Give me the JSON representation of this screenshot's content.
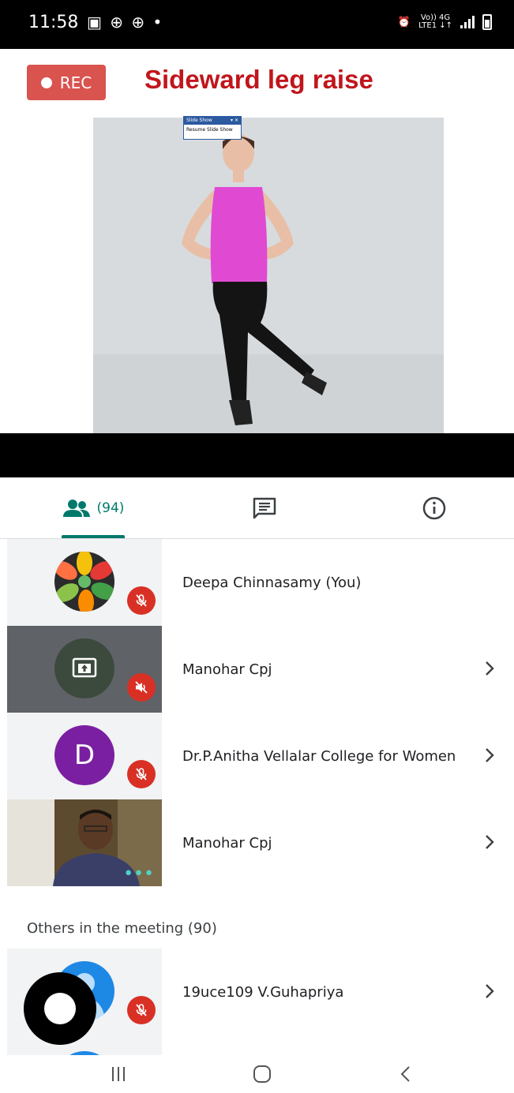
{
  "status_bar": {
    "time": "11:58",
    "network_top": "Vo)) 4G",
    "network_bottom": "LTE1 ↓↑"
  },
  "slide": {
    "rec_label": "REC",
    "title": "Sideward leg raise",
    "slideshow_toolbar": {
      "title": "Slide Show",
      "resume_label": "Resume Slide Show"
    }
  },
  "tabs": {
    "people_count": "(94)",
    "active_tab": "people",
    "accent_color": "#00796b"
  },
  "participants": [
    {
      "name": "Deepa Chinnasamy (You)",
      "avatar": "fruit-photo-avatar",
      "muted": true,
      "has_chevron": false
    },
    {
      "name": "Manohar Cpj",
      "avatar": "screen-share-icon",
      "muted": true,
      "has_chevron": true
    },
    {
      "name": "Dr.P.Anitha Vellalar College for Women",
      "avatar_letter": "D",
      "avatar_color": "#7b1fa2",
      "muted": true,
      "has_chevron": true
    },
    {
      "name": "Manohar Cpj",
      "avatar": "camera-video",
      "muted": false,
      "has_chevron": true
    }
  ],
  "others_section": {
    "header": "Others in the meeting (90)",
    "items": [
      {
        "name": "19uce109 V.Guhapriya",
        "avatar": "default-person-avatar",
        "muted": true,
        "has_chevron": true
      }
    ]
  },
  "colors": {
    "mute_red": "#d93025",
    "rec_red": "#d9534f",
    "title_red": "#c0161c"
  }
}
